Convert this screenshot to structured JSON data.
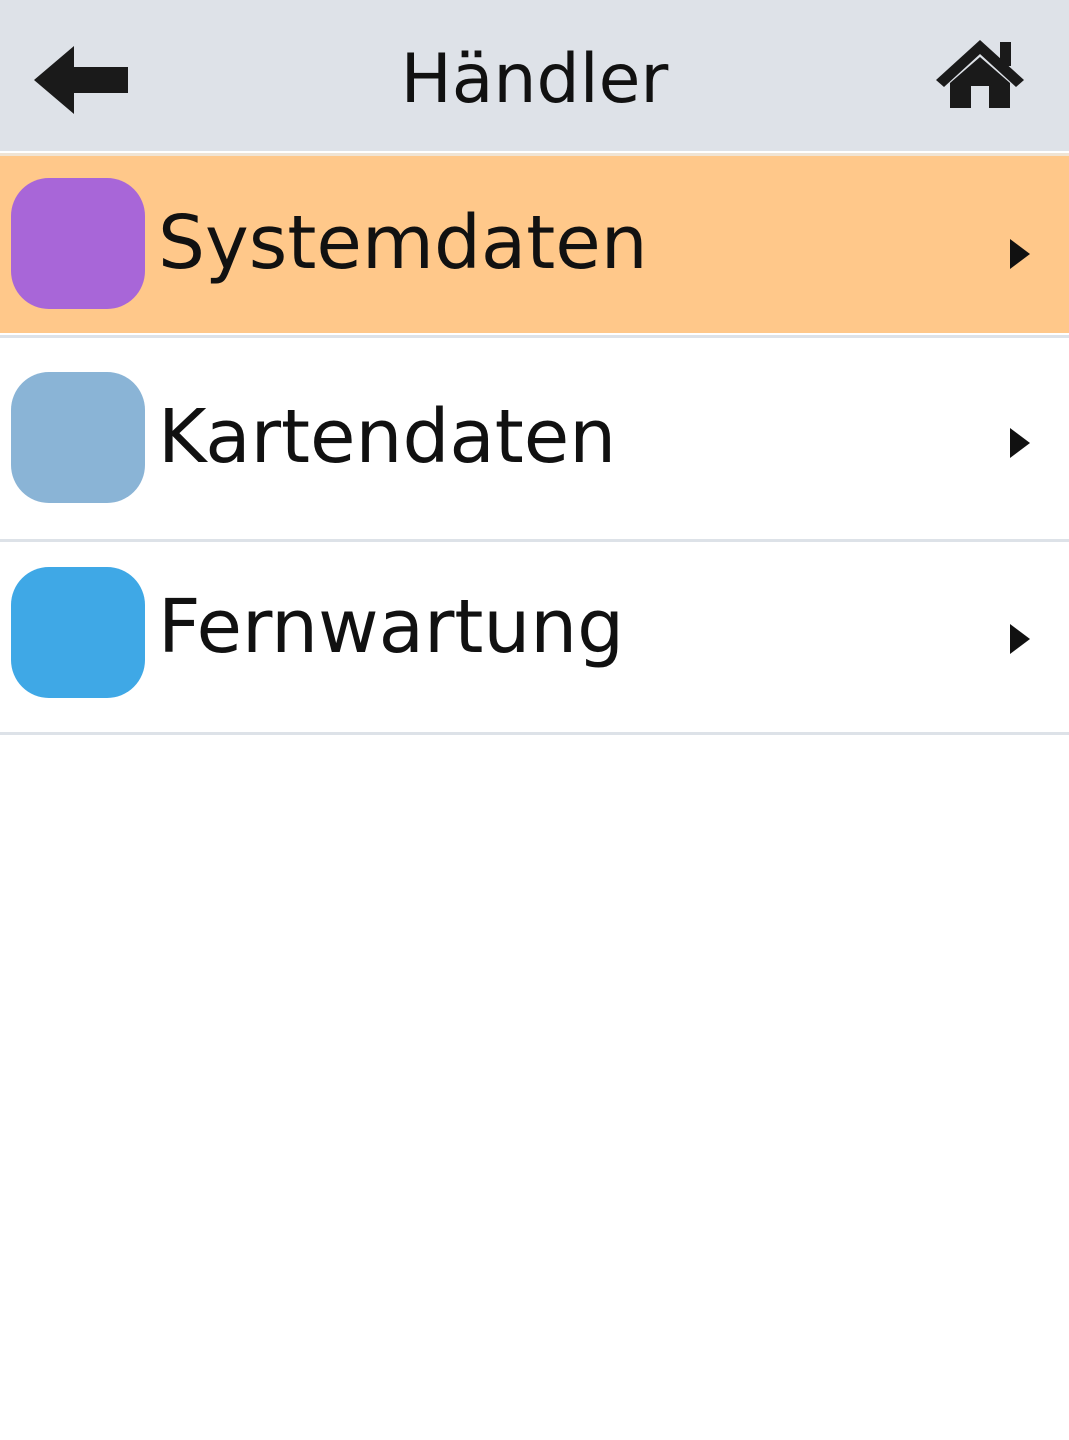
{
  "header": {
    "title": "Händler",
    "back_icon": "arrow-left-icon",
    "home_icon": "home-icon",
    "background": "#dee2e8"
  },
  "menu": {
    "items": [
      {
        "label": "Systemdaten",
        "icon": "chevron-right-icon",
        "tile_color": "#a866d8",
        "selected": true,
        "selected_background": "#ffc88a"
      },
      {
        "label": "Kartendaten",
        "icon": "chevron-right-icon",
        "tile_color": "#8ab4d6",
        "selected": false
      },
      {
        "label": "Fernwartung",
        "icon": "chevron-right-icon",
        "tile_color": "#3fa8e6",
        "selected": false
      }
    ]
  }
}
